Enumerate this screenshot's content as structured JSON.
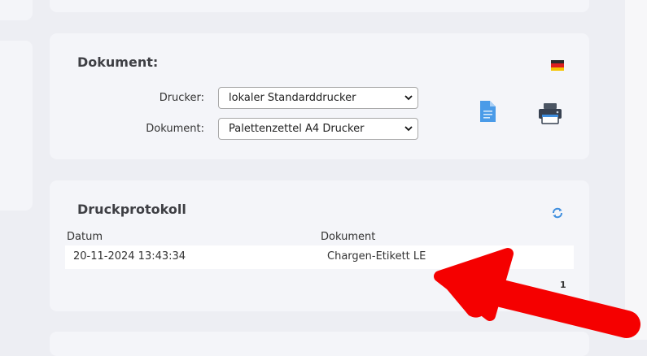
{
  "document_panel": {
    "title": "Dokument:",
    "printer_label": "Drucker:",
    "printer_value": "lokaler Standarddrucker",
    "document_label": "Dokument:",
    "document_value": "Palettenzettel A4 Drucker",
    "flag_icon": "german-flag-icon",
    "preview_icon": "document-icon",
    "print_icon": "printer-icon"
  },
  "print_log": {
    "title": "Druckprotokoll",
    "refresh_icon": "refresh-icon",
    "columns": [
      "Datum",
      "Dokument"
    ],
    "rows": [
      [
        "20-11-2024 13:43:34",
        "Chargen-Etikett LE"
      ]
    ],
    "page": "1"
  },
  "colors": {
    "accent_blue": "#3f8ede",
    "annotation_red": "#f50000",
    "panel": "#f4f5f9"
  }
}
